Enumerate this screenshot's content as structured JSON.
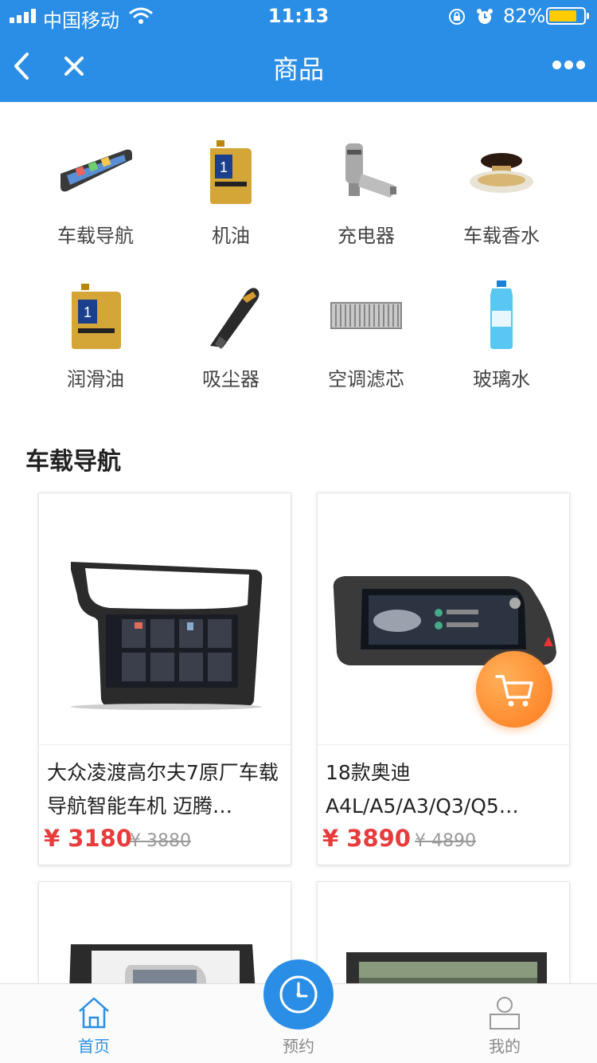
{
  "status_bar": {
    "carrier": "中国移动",
    "time": "11:13",
    "battery_percent": "82%",
    "battery_level": 0.82
  },
  "nav": {
    "title": "商品"
  },
  "categories": [
    {
      "label": "车载导航",
      "icon": "car-navigation-icon"
    },
    {
      "label": "机油",
      "icon": "engine-oil-icon"
    },
    {
      "label": "充电器",
      "icon": "car-charger-icon"
    },
    {
      "label": "车载香水",
      "icon": "car-perfume-icon"
    },
    {
      "label": "润滑油",
      "icon": "lubricant-icon"
    },
    {
      "label": "吸尘器",
      "icon": "vacuum-cleaner-icon"
    },
    {
      "label": "空调滤芯",
      "icon": "ac-filter-icon"
    },
    {
      "label": "玻璃水",
      "icon": "washer-fluid-icon"
    }
  ],
  "section": {
    "title": "车载导航"
  },
  "products": [
    {
      "name": "大众凌渡高尔夫7原厂车载导航智能车机 迈腾…",
      "price": "¥ 3180",
      "old_price": "¥ 3880"
    },
    {
      "name": "18款奥迪A4L/A5/A3/Q3/Q5…",
      "price": "¥ 3890",
      "old_price": "¥ 4890"
    }
  ],
  "tabbar": {
    "home": "首页",
    "booking": "预约",
    "mine": "我的"
  },
  "colors": {
    "primary": "#2a8ee6",
    "price": "#e83c3c",
    "cart": "#ff8a2b"
  }
}
